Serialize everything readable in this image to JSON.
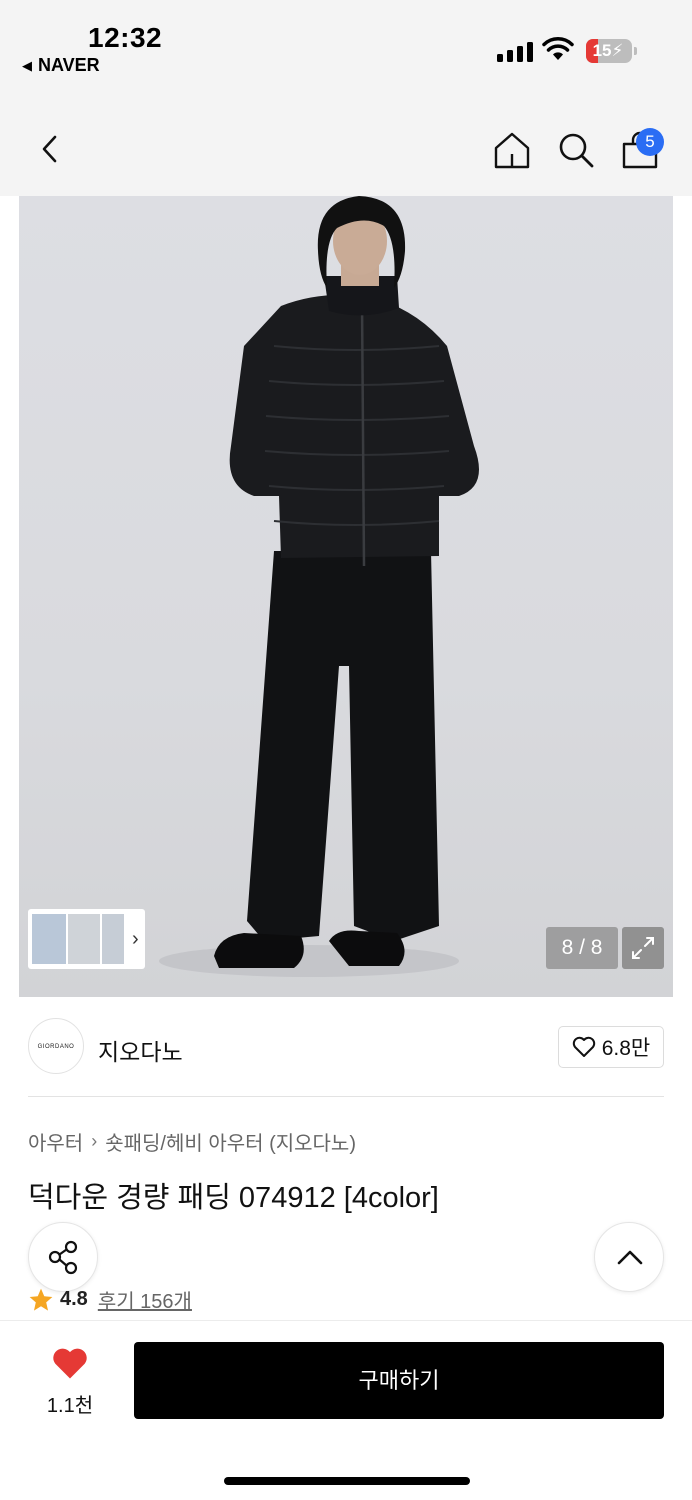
{
  "status_bar": {
    "time": "12:32",
    "back_app": "NAVER",
    "battery": "15"
  },
  "nav": {
    "cart_count": "5",
    "icons": [
      "chevron-left-icon",
      "home-icon",
      "search-icon",
      "shopping-bag-icon"
    ]
  },
  "gallery": {
    "counter": "8 / 8"
  },
  "brand": {
    "logo_text": "GIORDANO",
    "name": "지오다노",
    "likes": "6.8만"
  },
  "breadcrumb": {
    "category": "아우터",
    "subcategory": "숏패딩/헤비 아우터 (지오다노)"
  },
  "product": {
    "title": "덕다운 경량 패딩 074912 [4color]",
    "rating": "4.8",
    "reviews": "후기 156개"
  },
  "bottom": {
    "wish_count": "1.1천",
    "buy_label": "구매하기"
  },
  "colors": {
    "badge": "#2a6df4",
    "heart": "#e53935",
    "star": "#f5a623",
    "buy_button": "#000000"
  }
}
